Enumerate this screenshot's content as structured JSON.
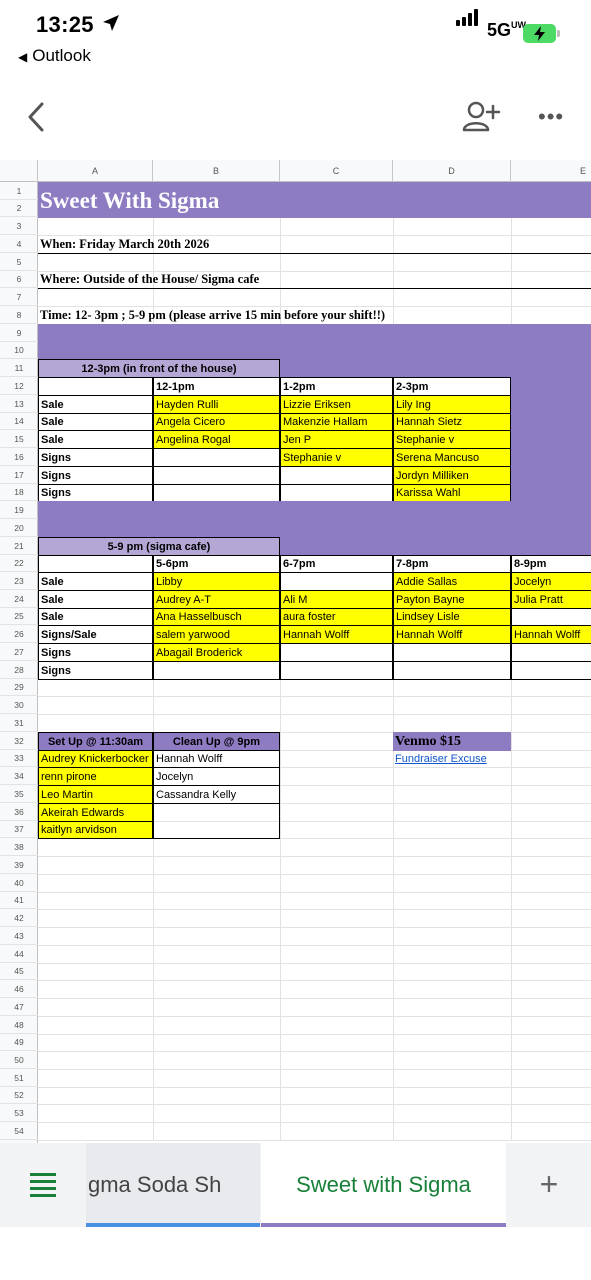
{
  "status_bar": {
    "time": "13:25",
    "back_app": "Outlook",
    "network": "5G",
    "network_suffix": "UW"
  },
  "toolbar": {
    "back_icon": "chevron-left-icon",
    "share_icon": "person-add-icon",
    "more_label": "•••"
  },
  "sheet": {
    "column_headers": [
      "A",
      "B",
      "C",
      "D",
      "E"
    ],
    "row_numbers": [
      "1",
      "2",
      "3",
      "4",
      "5",
      "6",
      "7",
      "8",
      "9",
      "10",
      "11",
      "12",
      "13",
      "14",
      "15",
      "16",
      "17",
      "18",
      "19",
      "20",
      "21",
      "22",
      "23",
      "24",
      "25",
      "26",
      "27",
      "28",
      "29",
      "30",
      "31",
      "32",
      "33",
      "34",
      "35",
      "36",
      "37",
      "38",
      "39",
      "40",
      "41",
      "42",
      "43",
      "44",
      "45",
      "46",
      "47",
      "48",
      "49",
      "50",
      "51",
      "52",
      "53",
      "54"
    ],
    "title": "Sweet With Sigma",
    "when": "When: Friday March 20th 2026",
    "where": "Where: Outside of the House/ Sigma cafe",
    "time_line": "Time: 12- 3pm ; 5-9 pm  (please arrive 15 min before your shift!!)",
    "block1": {
      "header": "12-3pm (in front of the house)",
      "slots": [
        "12-1pm",
        "1-2pm",
        "2-3pm"
      ],
      "roles": [
        "Sale",
        "Sale",
        "Sale",
        "Signs",
        "Signs",
        "Signs"
      ],
      "rows": [
        [
          "Hayden Rulli",
          "Lizzie Eriksen",
          "Lily Ing"
        ],
        [
          "Angela Cicero",
          "Makenzie Hallam",
          "Hannah Sietz"
        ],
        [
          "Angelina Rogal",
          "Jen P",
          "Stephanie v"
        ],
        [
          "",
          "Stephanie v",
          "Serena Mancuso"
        ],
        [
          "",
          "",
          "Jordyn Milliken"
        ],
        [
          "",
          "",
          "Karissa Wahl"
        ]
      ]
    },
    "block2": {
      "header": "5-9 pm (sigma cafe)",
      "slots": [
        "5-6pm",
        "6-7pm",
        "7-8pm",
        "8-9pm"
      ],
      "roles": [
        "Sale",
        "Sale",
        "Sale",
        "Signs/Sale",
        "Signs",
        "Signs"
      ],
      "rows": [
        [
          "Libby",
          "",
          "Addie Sallas",
          "Jocelyn"
        ],
        [
          "Audrey A-T",
          "Ali M",
          "Payton Bayne",
          "Julia Pratt"
        ],
        [
          "Ana Hasselbusch",
          "aura foster",
          "Lindsey Lisle",
          ""
        ],
        [
          "salem yarwood",
          "Hannah Wolff",
          "Hannah Wolff",
          "Hannah Wolff"
        ],
        [
          "Abagail Broderick",
          "",
          "",
          ""
        ],
        [
          "",
          "",
          "",
          ""
        ]
      ]
    },
    "setup": {
      "setup_header": "Set Up @ 11:30am",
      "cleanup_header": "Clean Up @ 9pm",
      "setup_names": [
        "Audrey Knickerbocker",
        "renn pirone",
        "Leo Martin",
        "Akeirah Edwards",
        "kaitlyn arvidson"
      ],
      "cleanup_names": [
        "Hannah Wolff",
        "Jocelyn",
        "Cassandra Kelly",
        "",
        ""
      ]
    },
    "venmo": "Venmo $15",
    "fundraiser_link": "Fundraiser Excuse"
  },
  "tabs": {
    "menu_icon": "hamburger-menu-icon",
    "previous_tab": "gma Soda Sh",
    "active_tab": "Sweet with Sigma",
    "add_label": "+"
  },
  "colors": {
    "purple": "#8e7cc3",
    "light_purple": "#b4a7d6",
    "yellow": "#ffff00",
    "green": "#188038",
    "link": "#1155cc"
  }
}
